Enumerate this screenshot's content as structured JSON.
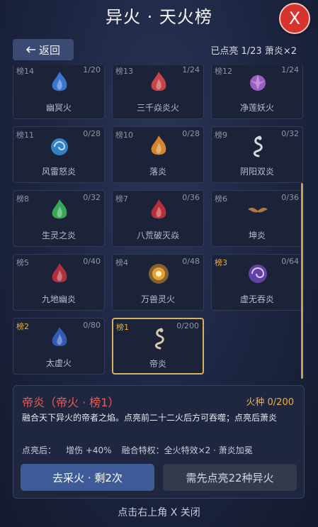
{
  "header": {
    "title": "异火 · 天火榜",
    "close_label": "X"
  },
  "back_label": "返回",
  "status": "已点亮 1/23  萧炎×2",
  "cells": [
    {
      "rank": "榜14",
      "progress": "1/20",
      "name": "幽冥火",
      "icon": "flame-icon",
      "color": "#3d7fe0",
      "gold": false,
      "selected": false
    },
    {
      "rank": "榜13",
      "progress": "1/24",
      "name": "三千焱炎火",
      "icon": "flame-icon",
      "color": "#d8494a",
      "gold": false,
      "selected": false
    },
    {
      "rank": "榜12",
      "progress": "1/24",
      "name": "净莲妖火",
      "icon": "lotus-flame-icon",
      "color": "#b06ad8",
      "gold": false,
      "selected": false
    },
    {
      "rank": "榜11",
      "progress": "0/28",
      "name": "风雷怒炎",
      "icon": "swirl-flame-icon",
      "color": "#3a8fe0",
      "gold": false,
      "selected": false
    },
    {
      "rank": "榜10",
      "progress": "0/28",
      "name": "落炎",
      "icon": "flame-icon",
      "color": "#e8902a",
      "gold": false,
      "selected": false
    },
    {
      "rank": "榜9",
      "progress": "0/32",
      "name": "阴阳双炎",
      "icon": "dragon-icon",
      "color": "#d8d8e0",
      "gold": false,
      "selected": false
    },
    {
      "rank": "榜8",
      "progress": "0/32",
      "name": "生灵之炎",
      "icon": "flame-icon",
      "color": "#3ab85a",
      "gold": false,
      "selected": false
    },
    {
      "rank": "榜7",
      "progress": "0/36",
      "name": "八荒破灭焱",
      "icon": "flame-icon",
      "color": "#c8323a",
      "gold": false,
      "selected": false
    },
    {
      "rank": "榜6",
      "progress": "0/36",
      "name": "坤炎",
      "icon": "bat-icon",
      "color": "#b07840",
      "gold": false,
      "selected": false
    },
    {
      "rank": "榜5",
      "progress": "0/40",
      "name": "九地幽炎",
      "icon": "flame-icon",
      "color": "#c03040",
      "gold": false,
      "selected": false
    },
    {
      "rank": "榜4",
      "progress": "0/48",
      "name": "万兽灵火",
      "icon": "burst-flame-icon",
      "color": "#e8a030",
      "gold": false,
      "selected": false
    },
    {
      "rank": "榜3",
      "progress": "0/64",
      "name": "虚无吞炎",
      "icon": "vortex-flame-icon",
      "color": "#8050d0",
      "gold": true,
      "selected": false
    },
    {
      "rank": "榜2",
      "progress": "0/80",
      "name": "太虚火",
      "icon": "flame-icon",
      "color": "#3560c8",
      "gold": true,
      "selected": false
    },
    {
      "rank": "榜1",
      "progress": "0/200",
      "name": "帝炎",
      "icon": "dragon-icon",
      "color": "#d8c8b0",
      "gold": true,
      "selected": true
    }
  ],
  "detail": {
    "name": "帝炎（帝火 · 榜1）",
    "count": "火种 0/200",
    "description": "融合天下异火的帝者之焰。点亮前二十二火后方可吞噬；点亮后萧炎",
    "effects": [
      "点亮后：",
      "增伤 +40%",
      "融合特权：全火特效×2 · 萧炎加冕"
    ]
  },
  "buttons": {
    "gather": "去采火 · 剩2次",
    "requirement": "需先点亮22种异火"
  },
  "footer_hint": "点击右上角 X 关闭",
  "colors": {
    "accent_gold": "#d6b35a",
    "close_red": "#d8322d",
    "title_red": "#ef5a4c"
  }
}
